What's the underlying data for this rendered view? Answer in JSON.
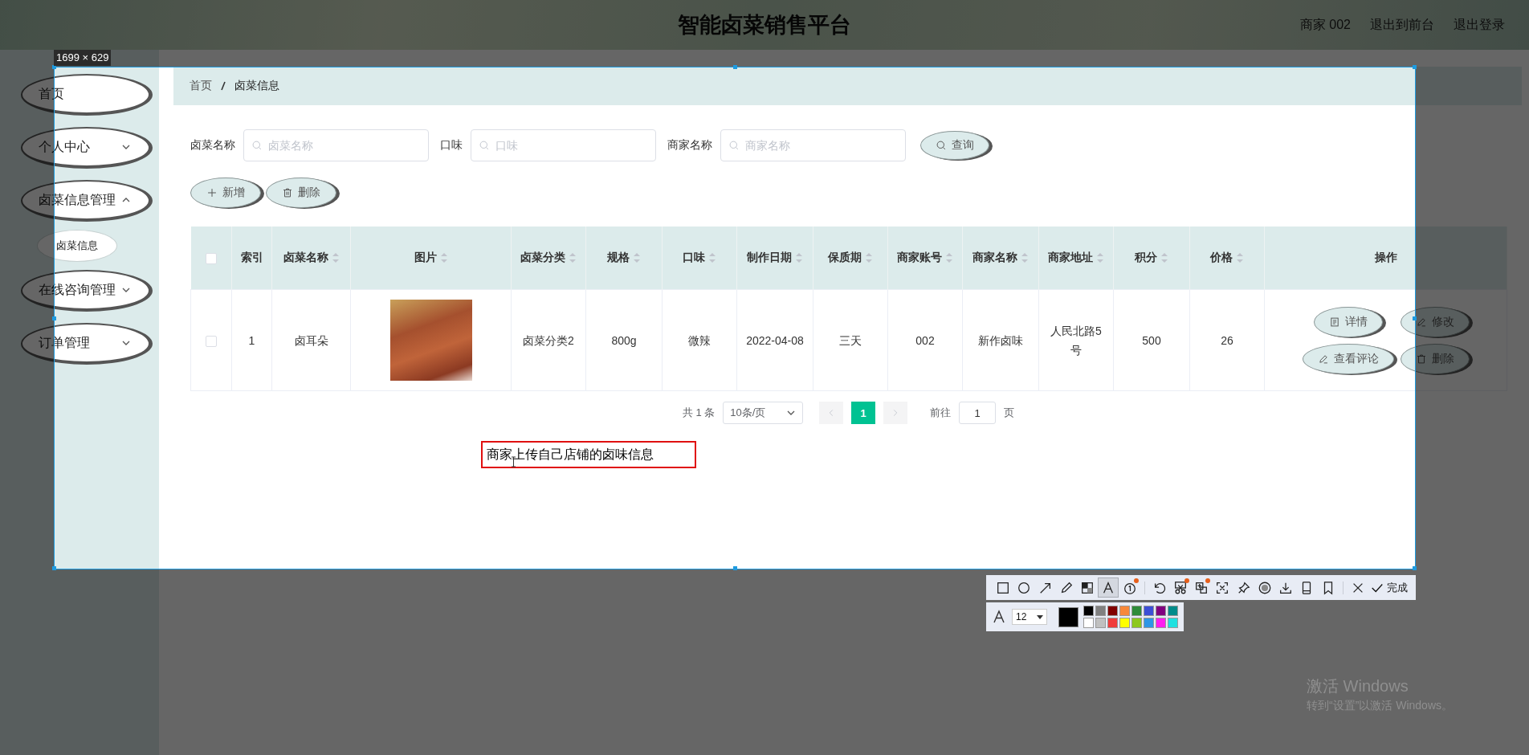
{
  "header": {
    "title": "智能卤菜销售平台",
    "links": [
      "商家 002",
      "退出到前台",
      "退出登录"
    ]
  },
  "sidebar": {
    "items": [
      {
        "label": "首页",
        "kind": "link",
        "selected": false
      },
      {
        "label": "个人中心",
        "kind": "submenu",
        "expanded": false,
        "selected": false
      },
      {
        "label": "卤菜信息管理",
        "kind": "submenu",
        "expanded": true,
        "selected": false,
        "children": [
          {
            "label": "卤菜信息",
            "selected": true
          }
        ]
      },
      {
        "label": "在线咨询管理",
        "kind": "submenu",
        "expanded": false,
        "selected": false
      },
      {
        "label": "订单管理",
        "kind": "submenu",
        "expanded": false,
        "selected": false
      }
    ]
  },
  "breadcrumb": [
    "首页",
    "卤菜信息"
  ],
  "search": {
    "fields": [
      {
        "label": "卤菜名称",
        "placeholder": "卤菜名称"
      },
      {
        "label": "口味",
        "placeholder": "口味"
      },
      {
        "label": "商家名称",
        "placeholder": "商家名称"
      }
    ],
    "button": "查询"
  },
  "actions": [
    {
      "label": "新增",
      "kind": "add"
    },
    {
      "label": "删除",
      "kind": "delete"
    }
  ],
  "table": {
    "select_all": {
      "checked": false
    },
    "columns": [
      {
        "label": "索引",
        "sortable": false
      },
      {
        "label": "卤菜名称",
        "sortable": true
      },
      {
        "label": "图片",
        "sortable": true
      },
      {
        "label": "卤菜分类",
        "sortable": true
      },
      {
        "label": "规格",
        "sortable": true
      },
      {
        "label": "口味",
        "sortable": true
      },
      {
        "label": "制作日期",
        "sortable": true
      },
      {
        "label": "保质期",
        "sortable": true
      },
      {
        "label": "商家账号",
        "sortable": true
      },
      {
        "label": "商家名称",
        "sortable": true
      },
      {
        "label": "商家地址",
        "sortable": true
      },
      {
        "label": "积分",
        "sortable": true
      },
      {
        "label": "价格",
        "sortable": true
      },
      {
        "label": "操作",
        "sortable": false
      }
    ],
    "rows": [
      {
        "checked": false,
        "cells": [
          {
            "kind": "text",
            "text": "1"
          },
          {
            "kind": "text",
            "text": "卤耳朵"
          },
          {
            "kind": "image"
          },
          {
            "kind": "text",
            "text": "卤菜分类2"
          },
          {
            "kind": "text",
            "text": "800g"
          },
          {
            "kind": "text",
            "text": "微辣"
          },
          {
            "kind": "text",
            "text": "2022-04-08"
          },
          {
            "kind": "text",
            "text": "三天"
          },
          {
            "kind": "text",
            "text": "002"
          },
          {
            "kind": "text",
            "text": "新作卤味"
          },
          {
            "kind": "text",
            "text": "人民北路5号"
          },
          {
            "kind": "text",
            "text": "500"
          },
          {
            "kind": "text",
            "text": "26"
          },
          {
            "kind": "actions",
            "buttons": [
              {
                "label": "详情",
                "kind": "detail"
              },
              {
                "label": "修改",
                "kind": "edit"
              },
              {
                "label": "查看评论",
                "kind": "comments"
              },
              {
                "label": "删除",
                "kind": "delete"
              }
            ]
          }
        ]
      }
    ]
  },
  "pagination": {
    "total": "共 1 条",
    "page_size": "10条/页",
    "pages": [
      {
        "label": "1",
        "selected": true
      }
    ],
    "goto_label": "前往",
    "goto_value": "1",
    "goto_suffix": "页"
  },
  "snip": {
    "size": "1699 × 629",
    "annotation": "商家上传自己店铺的卤味信息",
    "tool_groups": [
      [
        {
          "kind": "rect",
          "selected": false,
          "badge": false
        },
        {
          "kind": "ellipse",
          "selected": false,
          "badge": false
        },
        {
          "kind": "arrow",
          "selected": false,
          "badge": false
        },
        {
          "kind": "pencil",
          "selected": false,
          "badge": false
        },
        {
          "kind": "mosaic",
          "selected": false,
          "badge": false
        },
        {
          "kind": "text",
          "selected": true,
          "badge": false
        },
        {
          "kind": "step",
          "selected": false,
          "badge": true
        }
      ],
      [
        {
          "kind": "undo",
          "selected": false,
          "badge": false
        },
        {
          "kind": "scissors",
          "selected": false,
          "badge": true
        },
        {
          "kind": "translate",
          "selected": false,
          "badge": true
        },
        {
          "kind": "ocr",
          "selected": false,
          "badge": false
        },
        {
          "kind": "pin",
          "selected": false,
          "badge": false
        },
        {
          "kind": "record",
          "selected": false,
          "badge": false
        },
        {
          "kind": "download",
          "selected": false,
          "badge": false
        },
        {
          "kind": "phone",
          "selected": false,
          "badge": false
        },
        {
          "kind": "bookmark",
          "selected": false,
          "badge": false
        }
      ],
      [
        {
          "kind": "close",
          "selected": false,
          "badge": false
        }
      ]
    ],
    "done": "完成",
    "font_size": "12",
    "palette": [
      {
        "color": "#000000",
        "selected": true
      },
      {
        "color": "#808080",
        "selected": false
      },
      {
        "color": "#800000",
        "selected": false
      },
      {
        "color": "#f7883a",
        "selected": false
      },
      {
        "color": "#2e8b3a",
        "selected": false
      },
      {
        "color": "#3c4fd6",
        "selected": false
      },
      {
        "color": "#800080",
        "selected": false
      },
      {
        "color": "#008b8b",
        "selected": false
      },
      {
        "color": "#ffffff",
        "selected": false
      },
      {
        "color": "#c0c0c0",
        "selected": false
      },
      {
        "color": "#f03c3c",
        "selected": false
      },
      {
        "color": "#ffff00",
        "selected": false
      },
      {
        "color": "#8cc81e",
        "selected": false
      },
      {
        "color": "#2e96e6",
        "selected": false
      },
      {
        "color": "#ff1ef0",
        "selected": false
      },
      {
        "color": "#1ee0e0",
        "selected": false
      }
    ]
  },
  "watermark": {
    "title": "激活 Windows",
    "subtitle": "转到“设置”以激活 Windows。"
  }
}
